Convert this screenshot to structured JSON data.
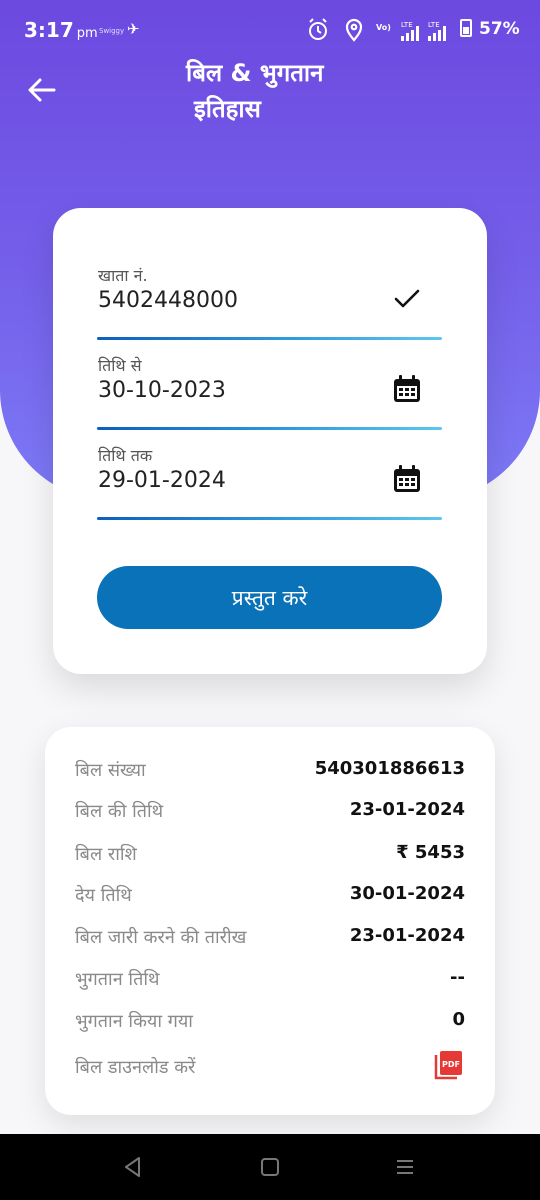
{
  "status_bar": {
    "time": "3:17",
    "ampm": "pm",
    "notif_text": "Swiggy",
    "notif_glyph": "✈",
    "network_label_1": "Vo)",
    "network_label_2": "LTE",
    "network_label_3": "LTE",
    "battery": "57%"
  },
  "header": {
    "title_line1": "बिल & भुगतान",
    "title_line2": "इतिहास"
  },
  "form": {
    "account_label": "खाता नं.",
    "account_value": "5402448000",
    "from_label": "तिथि से",
    "from_value": "30-10-2023",
    "to_label": "तिथि तक",
    "to_value": "29-01-2024",
    "submit_label": "प्रस्तुत करे"
  },
  "details": [
    {
      "label": "बिल संख्या",
      "value": "540301886613"
    },
    {
      "label": "बिल की तिथि",
      "value": "23-01-2024"
    },
    {
      "label": "बिल राशि",
      "value": "₹ 5453"
    },
    {
      "label": "देय तिथि",
      "value": "30-01-2024"
    },
    {
      "label": "बिल जारी करने की तारीख",
      "value": "23-01-2024"
    },
    {
      "label": "भुगतान तिथि",
      "value": "--"
    },
    {
      "label": "भुगतान किया गया",
      "value": "0"
    },
    {
      "label": "बिल डाउनलोड करें",
      "value": ""
    }
  ],
  "icons": {
    "back": "arrow-left",
    "account_check": "check",
    "date": "calendar",
    "download": "pdf"
  },
  "colors": {
    "accent": "#6c49e0",
    "button": "#0a72b8",
    "pdf": "#e53935"
  }
}
